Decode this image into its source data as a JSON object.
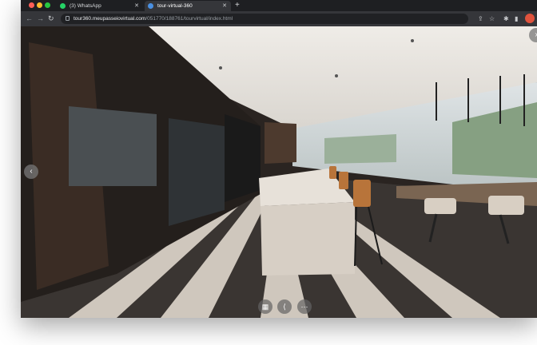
{
  "browser": {
    "tabs": [
      {
        "label": "(3) WhatsApp",
        "icon": "whatsapp-icon"
      },
      {
        "label": "tour-virtual-360",
        "icon": "globe-icon"
      }
    ],
    "new_tab": "+",
    "url_host": "tour360.meupasseiovirtual.com",
    "url_path": "/051770/188761/tourvirtual/index.html"
  },
  "viewer": {
    "controls": [
      {
        "name": "grid-icon",
        "glyph": "▦"
      },
      {
        "name": "share-icon",
        "glyph": "⟨"
      },
      {
        "name": "more-icon",
        "glyph": "⋯"
      }
    ],
    "nav_left": "‹",
    "nav_right": "›"
  },
  "colors": {
    "tab_active": "#35363a",
    "close_dot": "#ff5f57",
    "minimize_dot": "#febc2e",
    "zoom_dot": "#28c840"
  }
}
